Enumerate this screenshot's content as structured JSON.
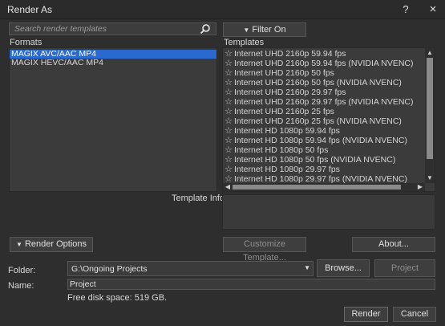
{
  "window": {
    "title": "Render As",
    "help_label": "?",
    "close_label": "×"
  },
  "search": {
    "placeholder": "Search render templates"
  },
  "filter_button": {
    "label": "Filter On"
  },
  "formats": {
    "label": "Formats",
    "items": [
      {
        "label": "MAGIX AVC/AAC MP4",
        "selected": true
      },
      {
        "label": "MAGIX HEVC/AAC MP4",
        "selected": false
      }
    ]
  },
  "templates": {
    "label": "Templates",
    "items": [
      "Internet UHD 2160p 59.94 fps",
      "Internet UHD 2160p 59.94 fps (NVIDIA NVENC)",
      "Internet UHD 2160p 50 fps",
      "Internet UHD 2160p 50 fps (NVIDIA NVENC)",
      "Internet UHD 2160p 29.97 fps",
      "Internet UHD 2160p 29.97 fps (NVIDIA NVENC)",
      "Internet UHD 2160p 25 fps",
      "Internet UHD 2160p 25 fps (NVIDIA NVENC)",
      "Internet HD 1080p 59.94 fps",
      "Internet HD 1080p 59.94 fps (NVIDIA NVENC)",
      "Internet HD 1080p 50 fps",
      "Internet HD 1080p 50 fps (NVIDIA NVENC)",
      "Internet HD 1080p 29.97 fps",
      "Internet HD 1080p 29.97 fps (NVIDIA NVENC)"
    ]
  },
  "template_info": {
    "label": "Template Info:"
  },
  "buttons": {
    "render_options": "Render Options",
    "customize_template": "Customize Template...",
    "about": "About...",
    "browse": "Browse...",
    "project_location": "Project Location",
    "render": "Render",
    "cancel": "Cancel"
  },
  "folder": {
    "label": "Folder:",
    "value": "G:\\Ongoing Projects"
  },
  "name": {
    "label": "Name:",
    "value": "Project"
  },
  "disk": {
    "text": "Free disk space: 519 GB."
  },
  "colors": {
    "selection": "#2a6ad0",
    "background": "#2e2e2e"
  }
}
